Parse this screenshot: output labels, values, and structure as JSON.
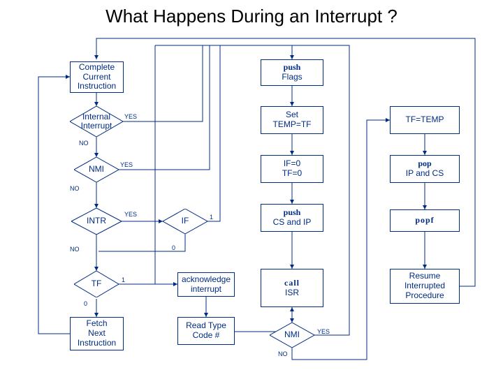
{
  "title": "What Happens During an Interrupt ?",
  "nodes": {
    "complete": {
      "l1": "Complete",
      "l2": "Current",
      "l3": "Instruction"
    },
    "internal": {
      "l1": "Internal",
      "l2": "Interrupt"
    },
    "nmi": "NMI",
    "intr": "INTR",
    "tf": "TF",
    "if": "IF",
    "fetch": {
      "l1": "Fetch",
      "l2": "Next",
      "l3": "Instruction"
    },
    "ack": {
      "l1": "acknowledge",
      "l2": "interrupt"
    },
    "readtype": {
      "l1": "Read Type",
      "l2": "Code #"
    },
    "pushflags": {
      "l1": "push",
      "l2": "Flags"
    },
    "settemp": {
      "l1": "Set",
      "l2": "TEMP=TF"
    },
    "ifzero": {
      "l1": "IF=0",
      "l2": "TF=0"
    },
    "pushcsip": {
      "l1": "push",
      "l2": "CS and IP"
    },
    "callisr": {
      "l1": "call",
      "l2": "ISR"
    },
    "nmi2": "NMI",
    "tftemp": "TF=TEMP",
    "popipcs": {
      "l1": "pop",
      "l2": "IP and CS"
    },
    "popf": "popf",
    "resume": {
      "l1": "Resume",
      "l2": "Interrupted",
      "l3": "Procedure"
    }
  },
  "labels": {
    "yes": "YES",
    "no": "NO",
    "one": "1",
    "zero": "0"
  }
}
